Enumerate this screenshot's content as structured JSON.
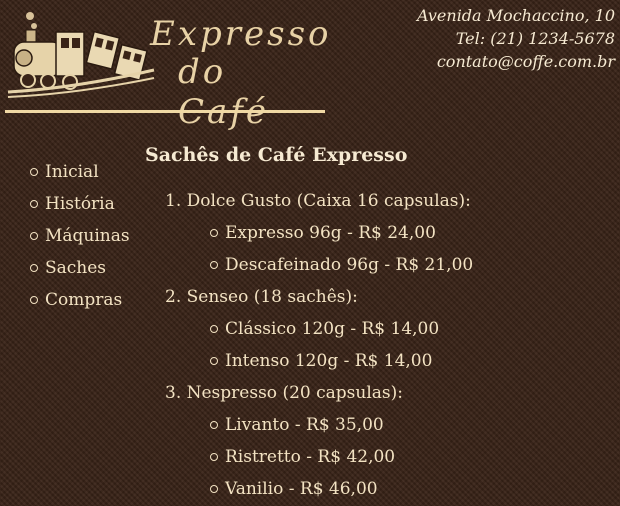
{
  "logo": {
    "line1": "Expresso",
    "line2": "do Café",
    "image_icon": "steam-train-icon"
  },
  "contact": {
    "address": "Avenida Mochaccino, 10",
    "phone": "Tel: (21) 1234-5678",
    "email": "contato@coffe.com.br"
  },
  "nav": {
    "items": [
      {
        "label": "Inicial"
      },
      {
        "label": "História"
      },
      {
        "label": "Máquinas"
      },
      {
        "label": "Saches"
      },
      {
        "label": "Compras"
      }
    ]
  },
  "main": {
    "title": "Sachês de Café Expresso",
    "categories": [
      {
        "label": "1. Dolce Gusto (Caixa 16 capsulas):",
        "items": [
          "Expresso 96g - R$ 24,00",
          "Descafeinado 96g - R$ 21,00"
        ]
      },
      {
        "label": "2. Senseo (18 sachês):",
        "items": [
          "Clássico 120g - R$ 14,00",
          "Intenso 120g - R$ 14,00"
        ]
      },
      {
        "label": "3. Nespresso (20 capsulas):",
        "items": [
          "Livanto - R$ 35,00",
          "Ristretto - R$ 42,00",
          "Vanilio - R$ 46,00"
        ]
      }
    ]
  },
  "colors": {
    "background": "#3a2418",
    "text": "#f3e3c3",
    "accent": "#f0d9a4"
  }
}
